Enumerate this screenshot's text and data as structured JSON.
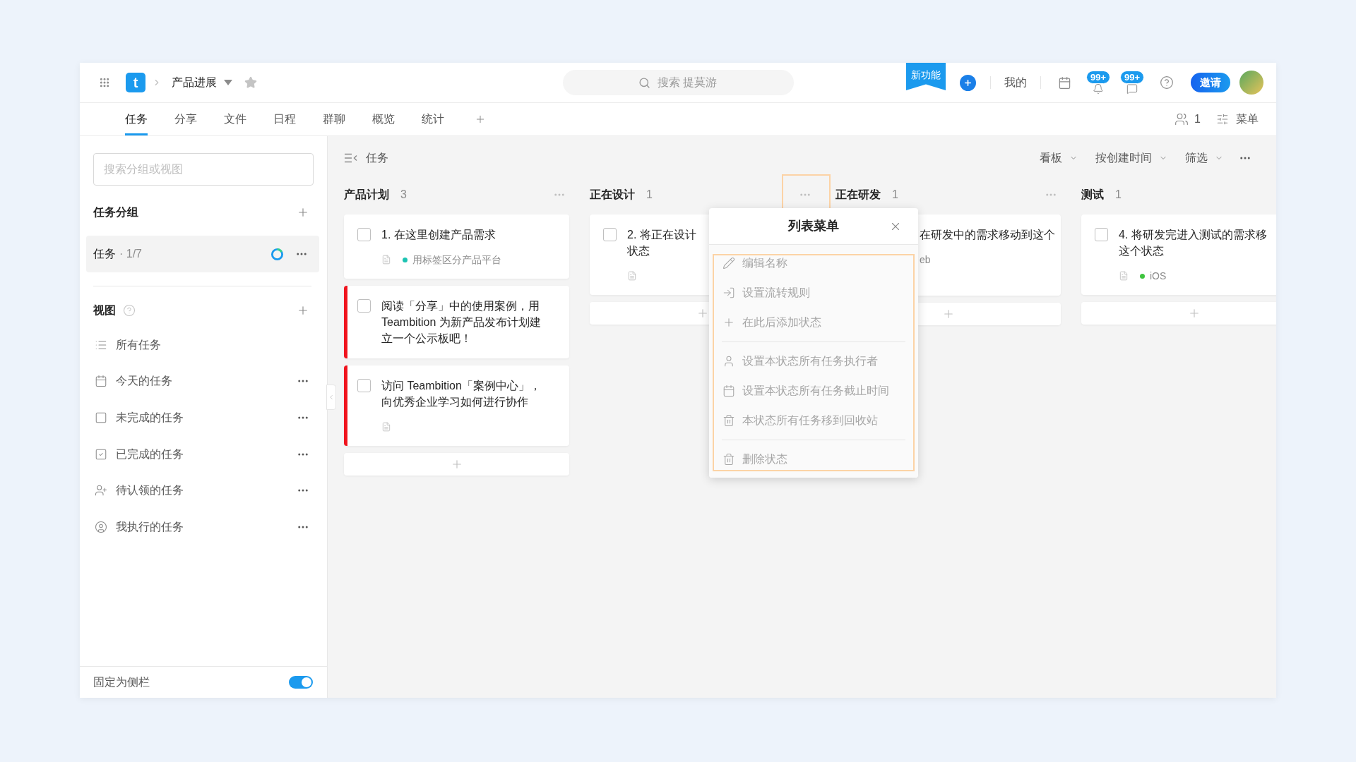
{
  "topbar": {
    "logo": "t",
    "project": "产品进展",
    "search": {
      "placeholder": "搜索 提莫游"
    },
    "ribbon": "新功能",
    "mine": "我的",
    "bell_badge": "99+",
    "chat_badge": "99+",
    "invite": "邀请"
  },
  "tabs": [
    {
      "label": "任务",
      "selected": true
    },
    {
      "label": "分享",
      "selected": false
    },
    {
      "label": "文件",
      "selected": false
    },
    {
      "label": "日程",
      "selected": false
    },
    {
      "label": "群聊",
      "selected": false
    },
    {
      "label": "概览",
      "selected": false
    },
    {
      "label": "统计",
      "selected": false
    }
  ],
  "tabbar_right": {
    "members": "1",
    "menu": "菜单"
  },
  "sidebar": {
    "search": {
      "placeholder": "搜索分组或视图"
    },
    "groups_title": "任务分组",
    "groups": [
      {
        "label": "任务",
        "count": "· 1/7",
        "selected": true
      }
    ],
    "views_title": "视图",
    "views": [
      {
        "label": "所有任务",
        "menu": false
      },
      {
        "label": "今天的任务",
        "menu": true
      },
      {
        "label": "未完成的任务",
        "menu": true
      },
      {
        "label": "已完成的任务",
        "menu": true
      },
      {
        "label": "待认领的任务",
        "menu": true
      },
      {
        "label": "我执行的任务",
        "menu": true
      }
    ],
    "pin": {
      "label": "固定为侧栏",
      "on": true
    }
  },
  "board": {
    "title": "任务",
    "controls": [
      "看板",
      "按创建时间",
      "筛选"
    ],
    "columns": [
      {
        "name": "产品计划",
        "count": "3",
        "cards": [
          {
            "lines": [
              "1. 在这里创建产品需求"
            ],
            "checked": false,
            "flagged": false,
            "note": true,
            "tag": {
              "label": "用标签区分产品平台",
              "color": "#1cc3b2"
            }
          },
          {
            "lines": [
              "阅读「分享」中的使用案例，用",
              "Teambition 为新产品发布计划建",
              "立一个公示板吧！"
            ],
            "checked": false,
            "flagged": true,
            "note": false
          },
          {
            "lines": [
              "访问 Teambition「案例中心」，",
              "向优秀企业学习如何进行协作"
            ],
            "checked": false,
            "flagged": true,
            "note": true
          }
        ]
      },
      {
        "name": "正在设计",
        "count": "1",
        "cards": [
          {
            "lines": [
              "2. 将正在设计",
              "状态"
            ],
            "checked": false,
            "flagged": false,
            "note": true
          }
        ],
        "menu": {
          "title": "列表菜单",
          "highlighted": true,
          "groups": [
            [
              "编辑名称",
              "设置流转规则",
              "在此后添加状态"
            ],
            [
              "设置本状态所有任务执行者",
              "设置本状态所有任务截止时间",
              "本状态所有任务移到回收站"
            ],
            [
              "删除状态"
            ]
          ]
        }
      },
      {
        "name": "正在研发",
        "count": "1",
        "cards": [
          {
            "lines": [
              "在研发中的需求移动到这个"
            ],
            "tag": {
              "label": "eb"
            }
          }
        ]
      },
      {
        "name": "测试",
        "count": "1",
        "cards": [
          {
            "lines": [
              "4. 将研发完进入测试的需求移",
              "这个状态"
            ],
            "checked": false,
            "flagged": false,
            "note": true,
            "tag": {
              "label": "iOS",
              "color": "#3fc43f"
            }
          }
        ]
      }
    ]
  }
}
